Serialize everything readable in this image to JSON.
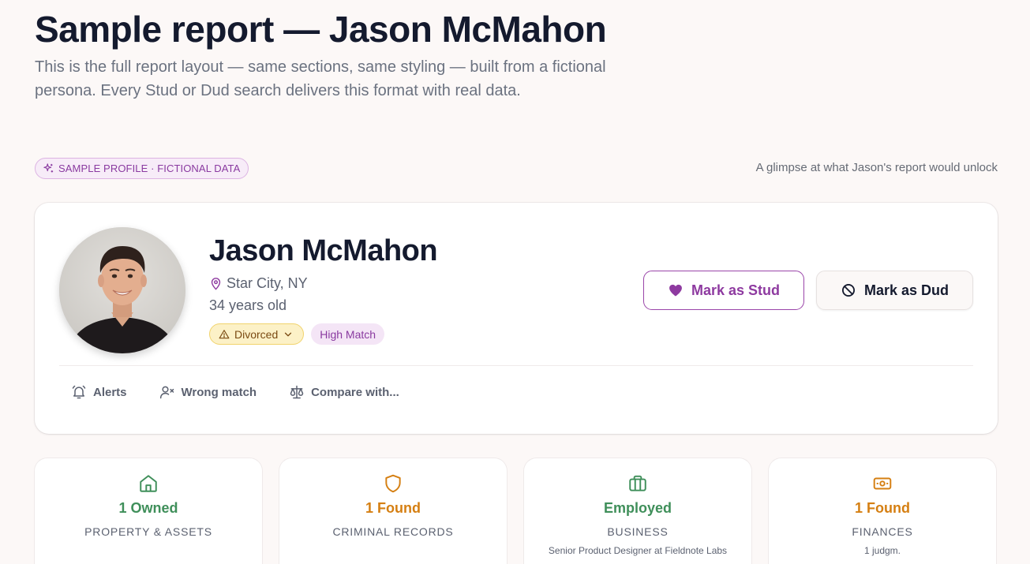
{
  "header": {
    "title": "Sample report — Jason McMahon",
    "subtitle": "This is the full report layout — same sections, same styling — built from a fictional persona. Every Stud or Dud search delivers this format with real data."
  },
  "banner": {
    "sample_label": "SAMPLE PROFILE · FICTIONAL DATA",
    "glimpse_text": "A glimpse at what Jason's report would unlock"
  },
  "profile": {
    "name": "Jason McMahon",
    "location": "Star City, NY",
    "age": "34 years old",
    "status_badge": "Divorced",
    "match_badge": "High Match",
    "stud_button": "Mark as Stud",
    "dud_button": "Mark as Dud",
    "actions": {
      "alerts": "Alerts",
      "wrong_match": "Wrong match",
      "compare": "Compare with..."
    }
  },
  "stats": [
    {
      "icon": "home-icon",
      "value": "1 Owned",
      "label": "PROPERTY & ASSETS",
      "sub": "",
      "color": "#3f8f5a"
    },
    {
      "icon": "shield-icon",
      "value": "1 Found",
      "label": "CRIMINAL RECORDS",
      "sub": "",
      "color": "#d57f12"
    },
    {
      "icon": "briefcase-icon",
      "value": "Employed",
      "label": "BUSINESS",
      "sub": "Senior Product Designer at Fieldnote Labs",
      "color": "#3f8f5a"
    },
    {
      "icon": "banknote-icon",
      "value": "1 Found",
      "label": "FINANCES",
      "sub": "1 judgm.",
      "color": "#d57f12"
    }
  ],
  "colors": {
    "accent": "#8e3aa0",
    "warning_bg": "#fcf1c7",
    "green": "#3f8f5a",
    "orange": "#d57f12"
  }
}
